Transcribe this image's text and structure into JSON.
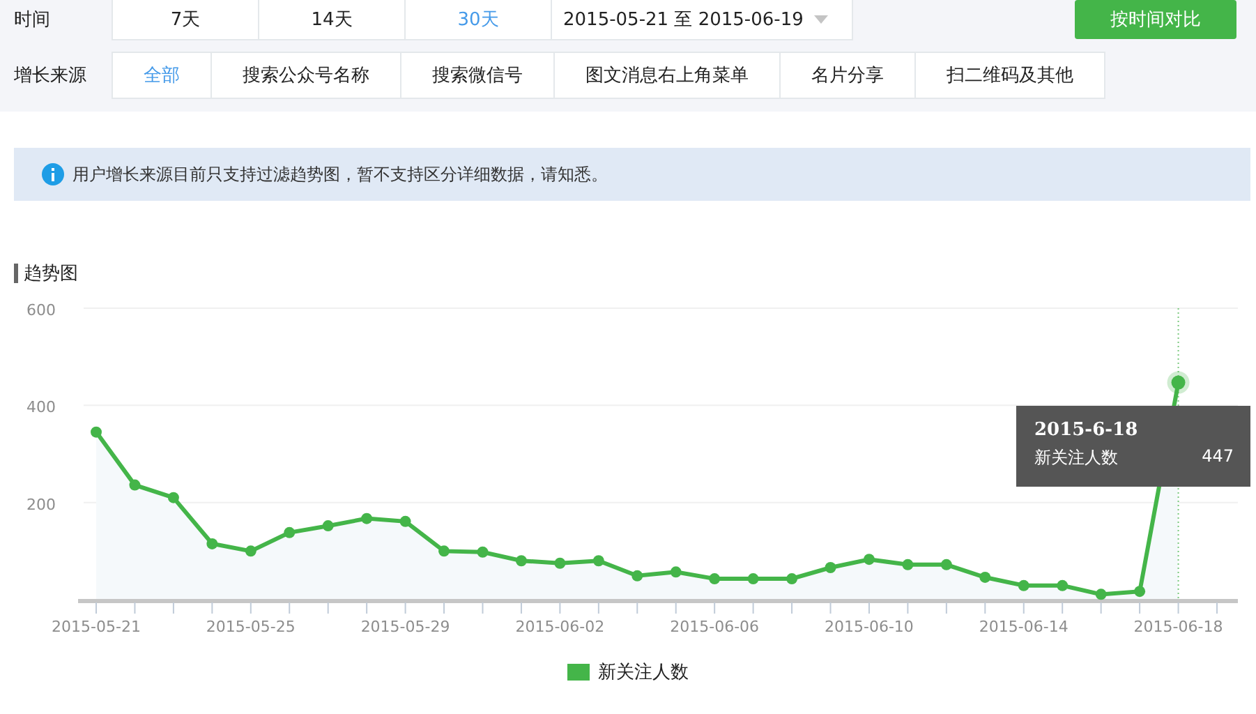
{
  "time_filter": {
    "label": "时间",
    "options": [
      {
        "label": "7天",
        "selected": false
      },
      {
        "label": "14天",
        "selected": false
      },
      {
        "label": "30天",
        "selected": true
      }
    ],
    "date_range": "2015-05-21 至 2015-06-19",
    "compare_button": "按时间对比"
  },
  "source_filter": {
    "label": "增长来源",
    "options": [
      {
        "label": "全部",
        "selected": true
      },
      {
        "label": "搜索公众号名称",
        "selected": false
      },
      {
        "label": "搜索微信号",
        "selected": false
      },
      {
        "label": "图文消息右上角菜单",
        "selected": false
      },
      {
        "label": "名片分享",
        "selected": false
      },
      {
        "label": "扫二维码及其他",
        "selected": false
      }
    ]
  },
  "notice": "用户增长来源目前只支持过滤趋势图，暂不支持区分详细数据，请知悉。",
  "chart": {
    "title": "趋势图",
    "chart_data": {
      "type": "area",
      "categories": [
        "2015-05-21",
        null,
        null,
        null,
        "2015-05-25",
        null,
        null,
        null,
        "2015-05-29",
        null,
        null,
        null,
        "2015-06-02",
        null,
        null,
        null,
        "2015-06-06",
        null,
        null,
        null,
        "2015-06-10",
        null,
        null,
        null,
        "2015-06-14",
        null,
        null,
        null,
        "2015-06-18",
        null
      ],
      "series": [
        {
          "name": "新关注人数",
          "color": "#44b549",
          "values": [
            345,
            236,
            210,
            115,
            100,
            138,
            152,
            167,
            161,
            100,
            98,
            80,
            75,
            80,
            49,
            57,
            43,
            43,
            43,
            66,
            83,
            72,
            72,
            46,
            29,
            29,
            11,
            17,
            447,
            null
          ]
        }
      ],
      "ylim": [
        0,
        600
      ],
      "yticks": [
        {
          "value": 200,
          "label": "200"
        },
        {
          "value": 400,
          "label": "400"
        },
        {
          "value": 600,
          "label": "600"
        }
      ]
    },
    "tooltip": {
      "date": "2015-6-18",
      "series_name": "新关注人数",
      "value": "447"
    }
  }
}
